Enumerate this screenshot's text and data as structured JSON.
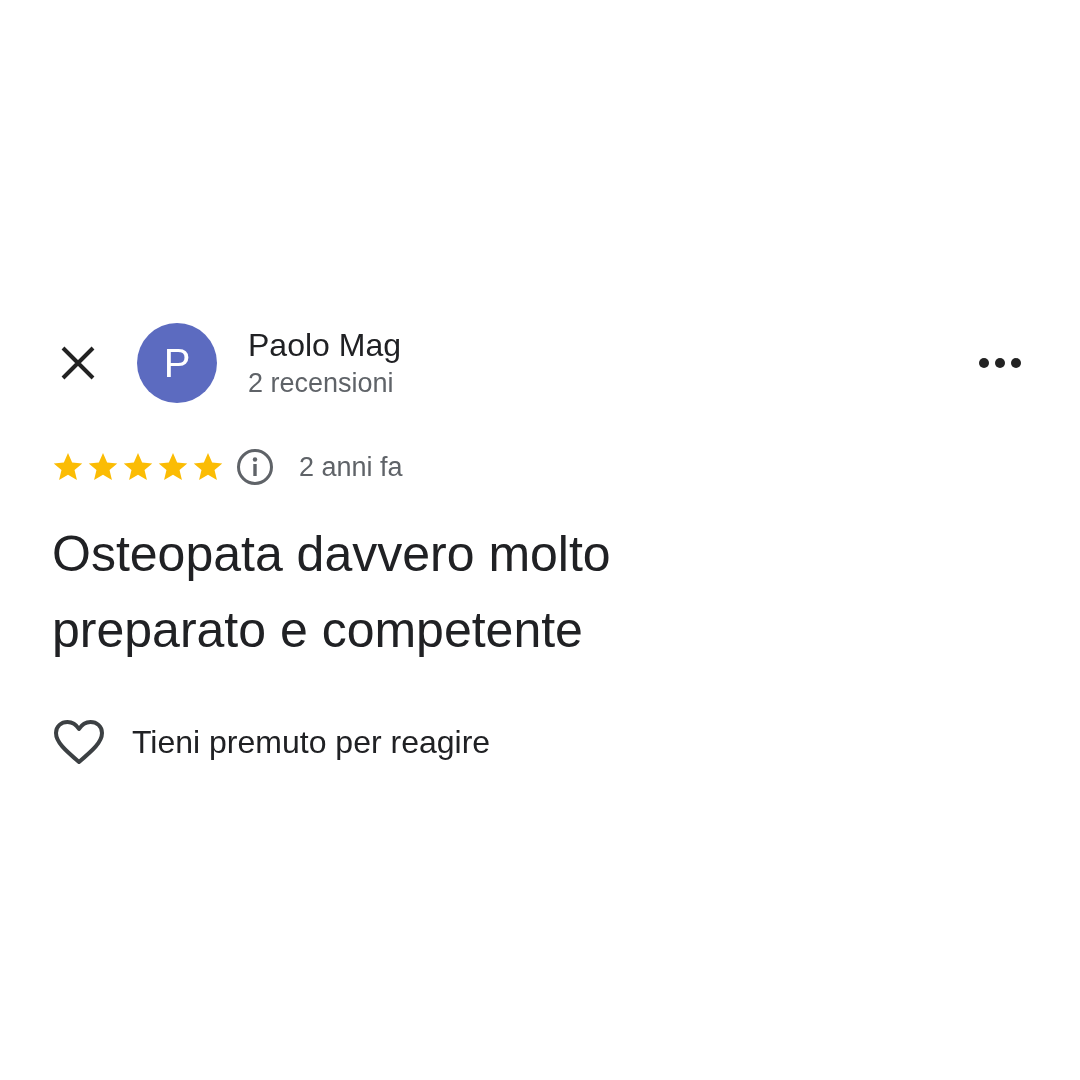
{
  "reviewer": {
    "initial": "P",
    "name": "Paolo Mag",
    "review_count": "2 recensioni"
  },
  "rating": {
    "stars": 5,
    "time": "2 anni fa"
  },
  "review_text": "Osteopata davvero molto preparato e competente",
  "reaction": {
    "liked": false,
    "label": "Tieni premuto per reagire"
  }
}
